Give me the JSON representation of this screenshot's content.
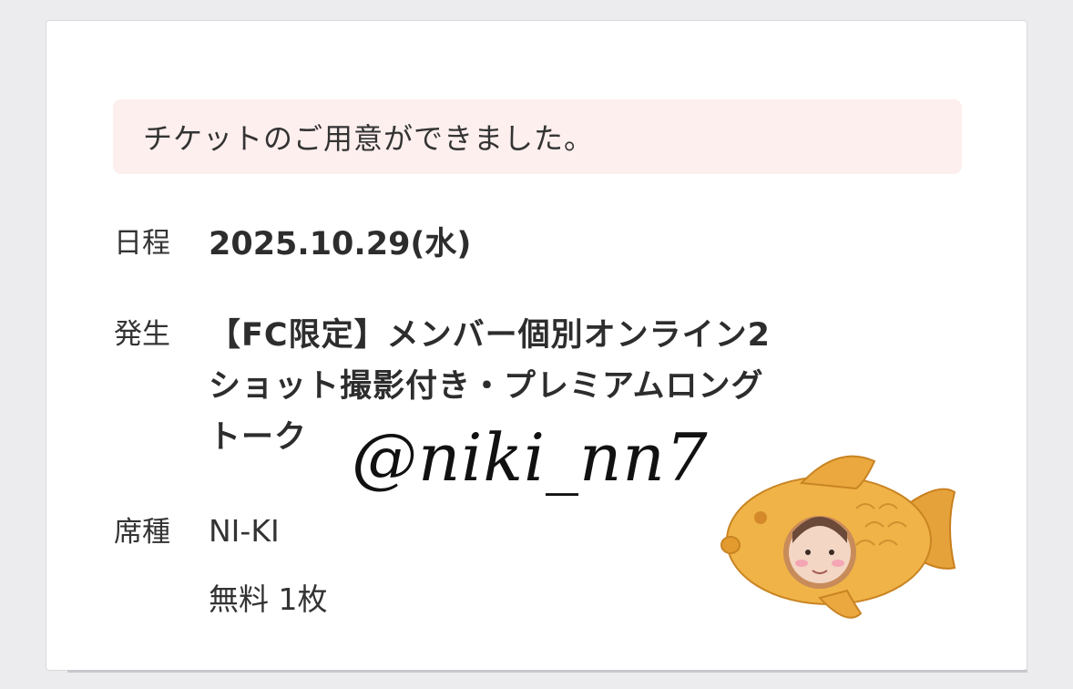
{
  "notice": {
    "text": "チケットのご用意ができました。"
  },
  "schedule": {
    "label": "日程",
    "value": "2025.10.29(水)"
  },
  "event": {
    "label": "発生",
    "lines": [
      "【FC限定】メンバー個別オンライン2",
      "ショット撮影付き・プレミアムロング",
      "トーク"
    ]
  },
  "seat": {
    "label": "席種",
    "member": "NI-KI",
    "price": "無料 1枚"
  },
  "overlay": {
    "watermark": "@niki_nn7",
    "sticker": "taiyaki-costume-sticker-icon"
  },
  "colors": {
    "notice_background": "#fdefee",
    "text": "#333333",
    "page_background": "#ececef"
  }
}
